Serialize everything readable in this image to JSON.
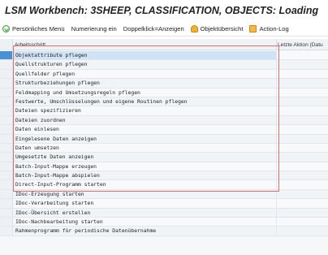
{
  "window": {
    "title": "LSM Workbench: 3SHEEP, CLASSIFICATION, OBJECTS: Loading"
  },
  "toolbar": {
    "items": [
      {
        "label": "Persönliches Menü",
        "icon": "check-circle-icon"
      },
      {
        "label": "Numerierung ein",
        "icon": ""
      },
      {
        "label": "Doppelklick=Anzeigen",
        "icon": ""
      },
      {
        "label": "Objektübersicht",
        "icon": "user-icon"
      },
      {
        "label": "Action-Log",
        "icon": "log-icon"
      }
    ]
  },
  "table": {
    "columns": [
      "Arbeitsschritt",
      "Letzte Aktion (Datu"
    ],
    "rows": [
      "Objektattribute pflegen",
      "Quellstrukturen pflegen",
      "Quellfelder pflegen",
      "Strukturbeziehungen pflegen",
      "Feldmapping und Umsetzungsregeln pflegen",
      "Festwerte, Umschlüsselungen und eigene Routinen pflegen",
      "Dateien spezifizieren",
      "Dateien zuordnen",
      "Daten einlesen",
      "Eingelesene Daten anzeigen",
      "Daten umsetzen",
      "Umgesetzte Daten anzeigen",
      "Batch-Input-Mappe erzeugen",
      "Batch-Input-Mappe abspielen",
      "Direct-Input-Programm starten",
      "IDoc-Erzeugung starten",
      "IDoc-Verarbeitung starten",
      "IDoc-Übersicht erstellen",
      "IDoc-Nachbearbeitung starten",
      "Rahmenprogramm für periodische Datenübernahme"
    ]
  },
  "colors": {
    "highlight_border": "#e06d73",
    "selected_row": "#cfe3f6",
    "selection_marker": "#4a90d9"
  }
}
